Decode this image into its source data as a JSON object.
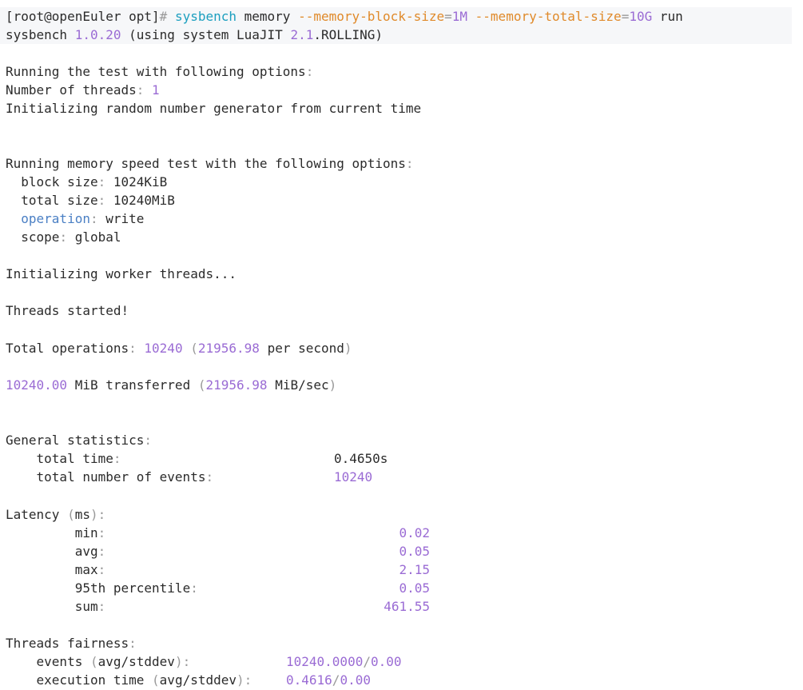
{
  "prompt": {
    "user_host": "[root@openEuler opt]",
    "symbol": "#",
    "command": "sysbench",
    "subcommand": "memory",
    "opt1_name": "--memory-block-size",
    "opt1_eq": "=",
    "opt1_val": "1M",
    "opt2_name": "--memory-total-size",
    "opt2_eq": "=",
    "opt2_val": "10G",
    "action": "run"
  },
  "version_line": {
    "name": "sysbench",
    "version": "1.0.20",
    "open": "(using system LuaJIT",
    "luajit_version": "2.1",
    "rest": ".ROLLING)"
  },
  "header": {
    "running_test": "Running the test with following options",
    "threads_label": "Number of threads",
    "threads_value": "1",
    "init_rng": "Initializing random number generator from current time"
  },
  "memory_options": {
    "title": "Running memory speed test with the following options",
    "block_size_label": "block size",
    "block_size_value": "1024KiB",
    "total_size_label": "total size",
    "total_size_value": "10240MiB",
    "operation_label": "operation",
    "operation_value": "write",
    "scope_label": "scope",
    "scope_value": "global"
  },
  "progress": {
    "init_workers": "Initializing worker threads...",
    "threads_started": "Threads started!"
  },
  "totals": {
    "total_ops_label": "Total operations",
    "total_ops_value": "10240",
    "per_second_value": "21956.98",
    "per_second_label": "per second",
    "transferred_value": "10240.00",
    "transferred_label": "MiB transferred",
    "mib_sec_value": "21956.98",
    "mib_sec_label": "MiB/sec"
  },
  "general_stats": {
    "title": "General statistics",
    "total_time_label": "total time",
    "total_time_value": "0.4650s",
    "total_events_label": "total number of events",
    "total_events_value": "10240"
  },
  "latency": {
    "title_word": "Latency",
    "unit": "ms",
    "rows": [
      {
        "label": "min",
        "value": "0.02"
      },
      {
        "label": "avg",
        "value": "0.05"
      },
      {
        "label": "max",
        "value": "2.15"
      },
      {
        "label": "95th percentile",
        "value": "0.05"
      },
      {
        "label": "sum",
        "value": "461.55"
      }
    ]
  },
  "fairness": {
    "title": "Threads fairness",
    "events_label": "events",
    "events_paren": "avg/stddev",
    "events_avg": "10240.0000",
    "events_stddev": "0.00",
    "exec_label": "execution time",
    "exec_paren": "avg/stddev",
    "exec_avg": "0.4616",
    "exec_stddev": "0.00"
  },
  "colors": {
    "punct": "#999999",
    "number": "#9a6bd4",
    "command": "#1c9fbf",
    "option": "#e08a2a",
    "keyword": "#4a7fc4",
    "text": "#2b2b2b"
  }
}
